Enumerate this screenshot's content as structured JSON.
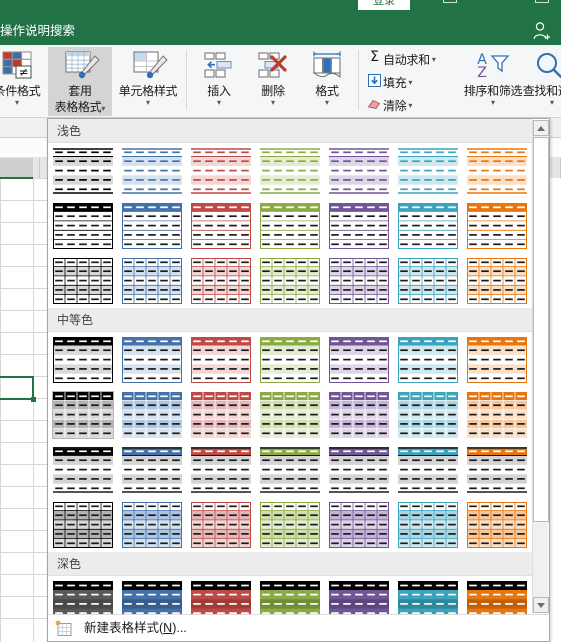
{
  "window": {
    "accent": "#217346",
    "active_tab_label": "登录",
    "tell_me": "操作说明搜索",
    "share_icon": "person-add-icon"
  },
  "ribbon": {
    "groups": [
      {
        "name": "styles",
        "buttons": [
          {
            "label_line1": "条件格式",
            "label_line2": "",
            "icon": "conditional-formatting-icon",
            "has_caret": true,
            "selected": false
          },
          {
            "label_line1": "套用",
            "label_line2": "表格格式",
            "icon": "format-as-table-icon",
            "has_caret": true,
            "selected": true
          },
          {
            "label_line1": "单元格样式",
            "label_line2": "",
            "icon": "cell-styles-icon",
            "has_caret": true,
            "selected": false
          }
        ]
      },
      {
        "name": "cells",
        "buttons": [
          {
            "label_line1": "插入",
            "label_line2": "",
            "icon": "insert-cells-icon",
            "has_caret": true,
            "selected": false
          },
          {
            "label_line1": "删除",
            "label_line2": "",
            "icon": "delete-cells-icon",
            "has_caret": true,
            "selected": false
          },
          {
            "label_line1": "格式",
            "label_line2": "",
            "icon": "format-cells-icon",
            "has_caret": true,
            "selected": false
          }
        ]
      },
      {
        "name": "editing",
        "small_buttons": [
          {
            "label": "自动求和",
            "icon": "sigma-icon",
            "has_caret": true
          },
          {
            "label": "填充",
            "icon": "fill-down-icon",
            "has_caret": true
          },
          {
            "label": "清除",
            "icon": "eraser-icon",
            "has_caret": true
          }
        ],
        "big_buttons": [
          {
            "label_line1": "排序和筛选",
            "label_line2": "",
            "icon": "sort-filter-icon",
            "has_caret": true
          },
          {
            "label_line1": "查找和选择",
            "label_line2": "",
            "icon": "find-select-icon",
            "has_caret": true
          }
        ]
      }
    ]
  },
  "gallery": {
    "name": "table-styles-gallery",
    "sections": [
      {
        "title": "浅色",
        "rows": 3
      },
      {
        "title": "中等色",
        "rows": 4
      },
      {
        "title": "深色",
        "rows": 1
      }
    ],
    "column_colors": [
      "#000000",
      "#4472a8",
      "#bf4a45",
      "#8bab45",
      "#715596",
      "#3aa3bd",
      "#e8760c"
    ],
    "column_tints": [
      "#d9d9d9",
      "#d6e2f0",
      "#f3d7d6",
      "#e4ecd3",
      "#ded5e9",
      "#cfe8ef",
      "#fbe0c8"
    ],
    "column_tints_light": [
      "#ececec",
      "#e8f0f8",
      "#f9e9e9",
      "#f1f5e7",
      "#efeaf4",
      "#e7f3f7",
      "#fdf0e4"
    ],
    "column_tints_mid": [
      "#b4b4b4",
      "#adc5e2",
      "#e5b8b7",
      "#cddfab",
      "#c5b4d8",
      "#a9d8e4",
      "#f8c69a"
    ],
    "dark_colors": [
      "#595959",
      "#4472a8",
      "#bf4a45",
      "#8bab45",
      "#715596",
      "#3aa3bd",
      "#e8760c"
    ],
    "highlighted_thumb": {
      "section": 1,
      "row": 1,
      "col": 0
    },
    "scrollbar": {
      "name": "gallery-vertical-scrollbar",
      "up_icon": "triangle-up-icon",
      "down_icon": "triangle-down-icon"
    },
    "footer": {
      "label_prefix": "新建表格样式(",
      "accel": "N",
      "label_suffix": ")...",
      "icon": "new-table-style-icon"
    }
  },
  "sheet": {
    "name": "worksheet-grid",
    "selected_cell_visible": true
  }
}
